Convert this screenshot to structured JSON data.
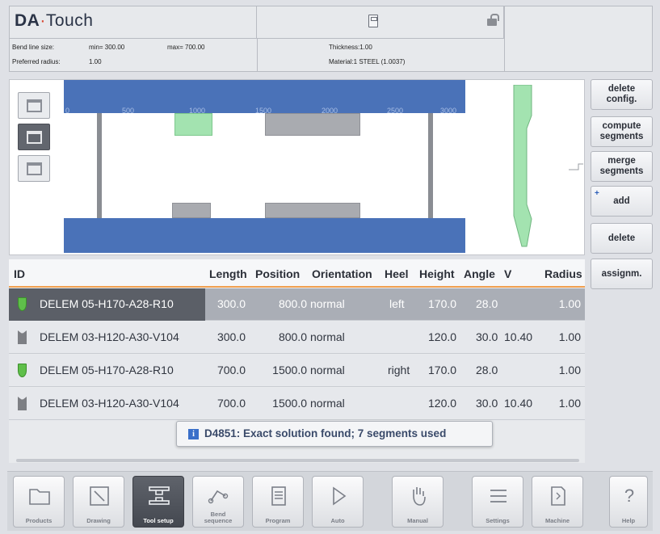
{
  "header": {
    "brand_main": "DA",
    "brand_dot": "·",
    "brand_sub": "Touch",
    "bend_line_size_label": "Bend line size:",
    "min_label": "min= 300.00",
    "max_label": "max= 700.00",
    "preferred_radius_label": "Preferred radius:",
    "preferred_radius_value": "1.00",
    "thickness": "Thickness:1.00",
    "material": "Material:1 STEEL (1.0037)"
  },
  "graphic": {
    "ruler_ticks": [
      "0",
      "500",
      "1000",
      "1500",
      "2000",
      "2500",
      "3000"
    ],
    "view_buttons": [
      "front-view-icon",
      "press-view-icon",
      "side-view-icon"
    ],
    "active_view": 1,
    "colors": {
      "beam": "#4a72b8",
      "tool_selected": "#a3e3b0",
      "tool": "#a9abb0"
    }
  },
  "side_buttons": {
    "delete_config": "delete\nconfig.",
    "compute_segments": "compute\nsegments",
    "merge_segments": "merge\nsegments",
    "add_plus": "+",
    "add": "add",
    "delete": "delete",
    "assignm": "assignm."
  },
  "table": {
    "headers": {
      "id": "ID",
      "length": "Length",
      "position": "Position",
      "orientation": "Orientation",
      "heel": "Heel",
      "height": "Height",
      "angle": "Angle",
      "v": "V",
      "radius": "Radius"
    },
    "rows": [
      {
        "type": "punch",
        "id": "DELEM 05-H170-A28-R10",
        "length": "300.0",
        "position": "800.0",
        "orientation": "normal",
        "heel": "left",
        "height": "170.0",
        "angle": "28.0",
        "v": "",
        "radius": "1.00"
      },
      {
        "type": "die",
        "id": "DELEM 03-H120-A30-V104",
        "length": "300.0",
        "position": "800.0",
        "orientation": "normal",
        "heel": "",
        "height": "120.0",
        "angle": "30.0",
        "v": "10.40",
        "radius": "1.00"
      },
      {
        "type": "punch",
        "id": "DELEM 05-H170-A28-R10",
        "length": "700.0",
        "position": "1500.0",
        "orientation": "normal",
        "heel": "right",
        "height": "170.0",
        "angle": "28.0",
        "v": "",
        "radius": "1.00"
      },
      {
        "type": "die",
        "id": "DELEM 03-H120-A30-V104",
        "length": "700.0",
        "position": "1500.0",
        "orientation": "normal",
        "heel": "",
        "height": "120.0",
        "angle": "30.0",
        "v": "10.40",
        "radius": "1.00"
      }
    ],
    "selected_row": 0
  },
  "toast": {
    "icon": "i",
    "message": "D4851: Exact solution found; 7 segments used"
  },
  "nav": {
    "products": "Products",
    "drawing": "Drawing",
    "tool_setup": "Tool setup",
    "bend_sequence": "Bend\nsequence",
    "program": "Program",
    "auto": "Auto",
    "manual": "Manual",
    "settings": "Settings",
    "machine": "Machine",
    "help": "Help",
    "help_glyph": "?"
  }
}
